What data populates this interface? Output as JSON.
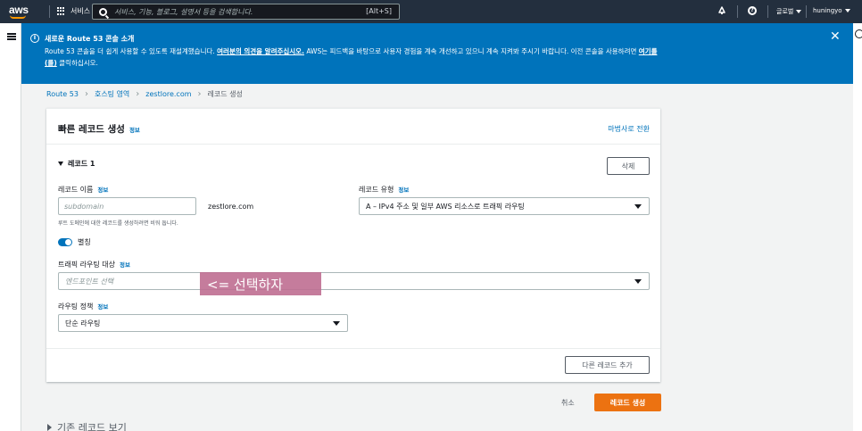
{
  "nav": {
    "logo": "aws",
    "services": "서비스",
    "search_placeholder": "서비스, 기능, 블로그, 설명서 등을 검색합니다.",
    "search_shortcut": "[Alt+S]",
    "region": "글로벌",
    "user": "huningyo"
  },
  "flash": {
    "title": "새로운 Route 53 콘솔 소개",
    "body_start": "Route 53 콘솔을 더 쉽게 사용할 수 있도록 재설계했습니다. ",
    "feedback_link": "여러분의 의견을 알려주십시오.",
    "body_mid": " AWS는 피드백을 바탕으로 사용자 경험을 계속 개선하고 있으니 계속 지켜봐 주시기 바랍니다. 이전 콘솔을 사용하려면 ",
    "here_link": "여기를",
    "here_link2": "(를)",
    "body_end": " 클릭하십시오."
  },
  "breadcrumb": {
    "items": [
      "Route 53",
      "호스팅 영역",
      "zestlore.com"
    ],
    "current": "레코드 생성"
  },
  "panel": {
    "title": "빠른 레코드 생성",
    "info": "정보",
    "wizard_link": "마법사로 전환",
    "record_header": "레코드 1",
    "delete_label": "삭제",
    "record_name_label": "레코드 이름",
    "record_name_placeholder": "subdomain",
    "domain_suffix": "zestlore.com",
    "record_name_hint": "루트 도메인에 대한 레코드를 생성하려면 비워 둡니다.",
    "record_type_label": "레코드 유형",
    "record_type_value": "A – IPv4 주소 및 일부 AWS 리소스로 트래픽 라우팅",
    "alias_label": "별칭",
    "alias_on": true,
    "routing_target_label": "트래픽 라우팅 대상",
    "routing_target_placeholder": "엔드포인트 선택",
    "routing_policy_label": "라우팅 정책",
    "routing_policy_value": "단순 라우팅",
    "add_record_label": "다른 레코드 추가"
  },
  "annotation": "<= 선택하자",
  "footer": {
    "cancel_label": "취소",
    "create_label": "레코드 생성",
    "existing_label": "기존 레코드 보기"
  },
  "colors": {
    "nav_bg": "#232f3e",
    "flash_bg": "#0073bb",
    "link": "#0073bb",
    "primary_button": "#ec7211",
    "annotation_bg": "#bf6e92"
  }
}
